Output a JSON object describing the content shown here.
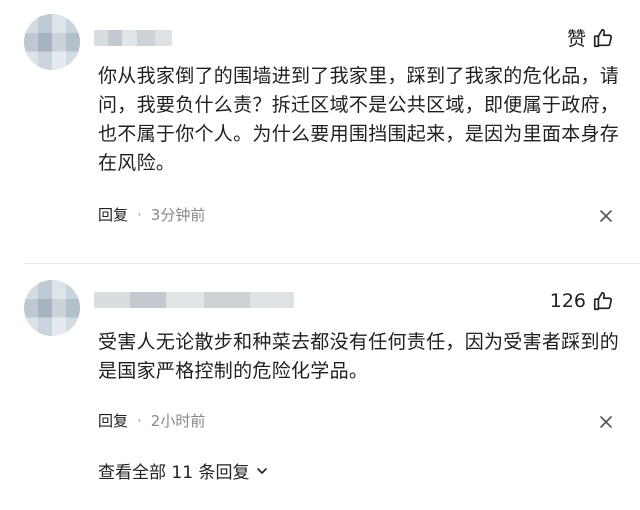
{
  "comments": [
    {
      "like_label": "赞",
      "text": "你从我家倒了的围墙进到了我家里，踩到了我家的危化品，请问，我要负什么责？拆迁区域不是公共区域，即便属于政府，也不属于你个人。为什么要用围挡围起来，是因为里面本身存在风险。",
      "reply_label": "回复",
      "separator": "·",
      "time": "3分钟前"
    },
    {
      "like_label": "126",
      "text": "受害人无论散步和种菜去都没有任何责任，因为受害者踩到的是国家严格控制的危险化学品。",
      "reply_label": "回复",
      "separator": "·",
      "time": "2小时前",
      "view_replies_label": "查看全部 11 条回复"
    }
  ],
  "icons": {
    "like": "thumbs-up-icon",
    "more": "close-icon",
    "expand": "chevron-down-icon"
  }
}
